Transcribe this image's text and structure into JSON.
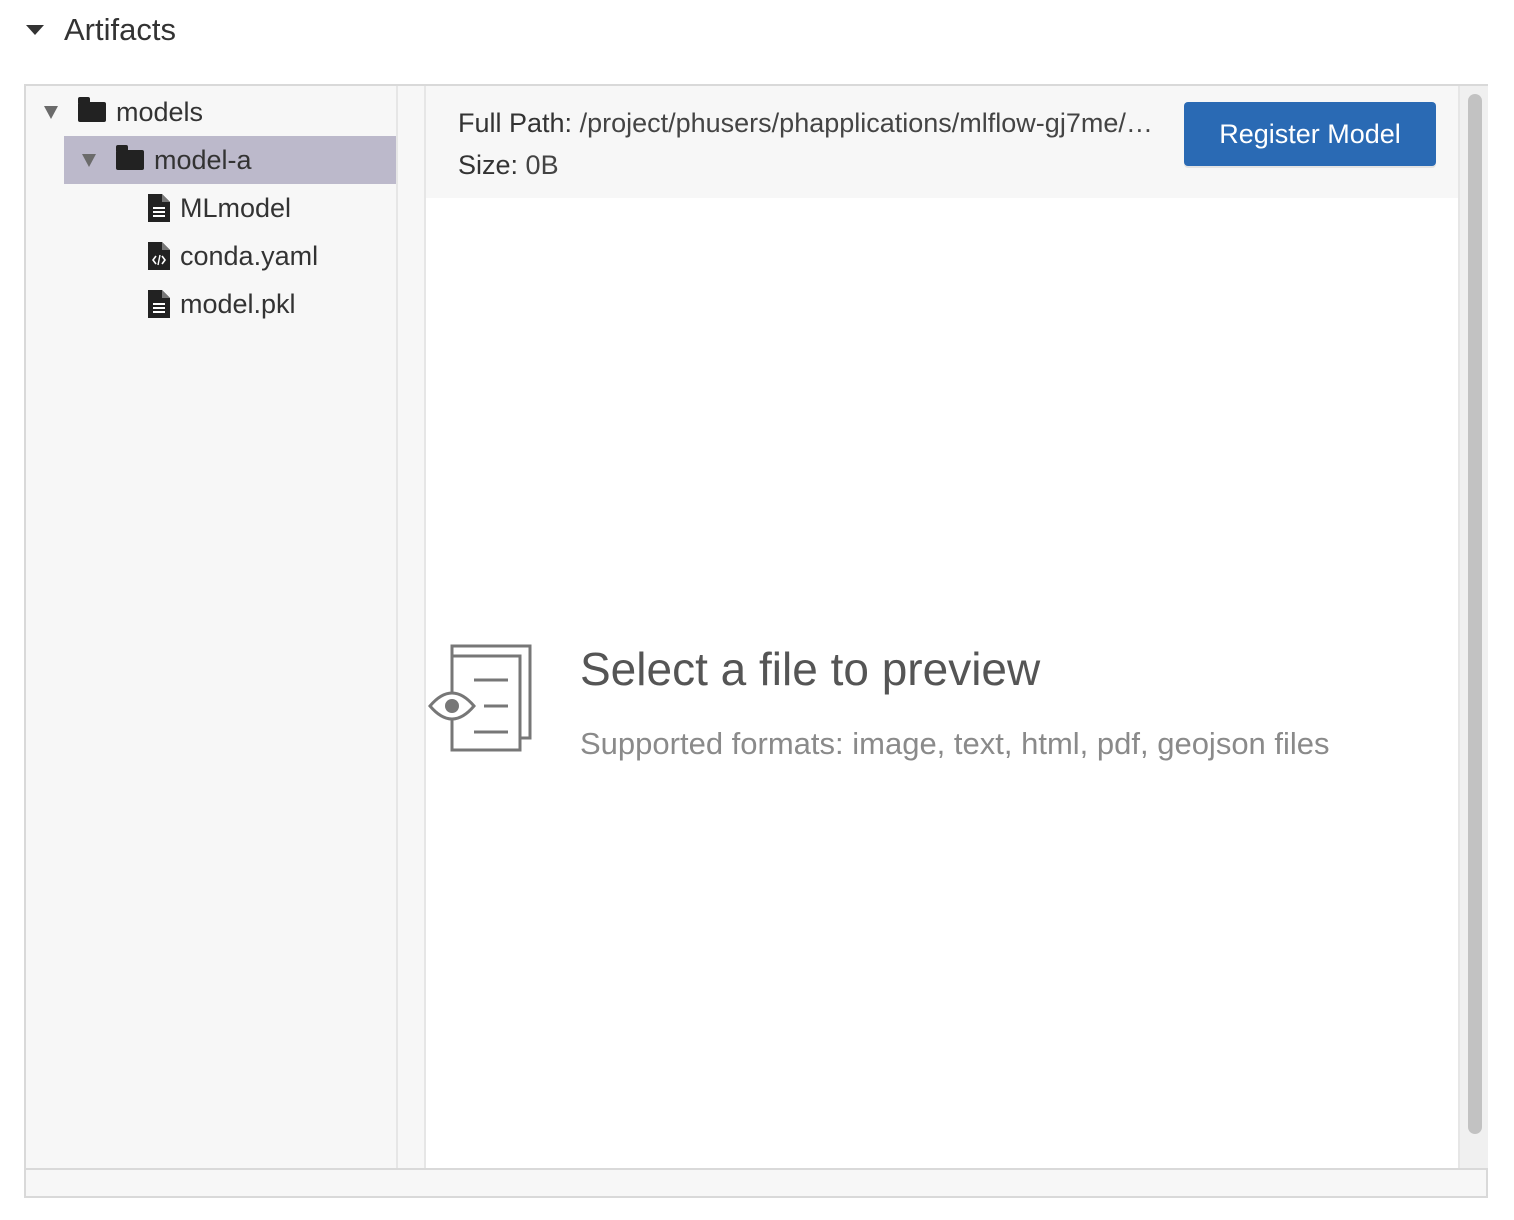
{
  "section": {
    "title": "Artifacts",
    "caret_icon": "caret-down-icon"
  },
  "tree": {
    "root": {
      "label": "models",
      "icon": "folder-icon",
      "expanded": true
    },
    "child": {
      "label": "model-a",
      "icon": "folder-icon",
      "expanded": true,
      "selected": true,
      "selected_color": "#bcb9cb"
    },
    "files": [
      {
        "label": "MLmodel",
        "icon": "file-text-icon"
      },
      {
        "label": "conda.yaml",
        "icon": "file-code-icon"
      },
      {
        "label": "model.pkl",
        "icon": "file-text-icon"
      }
    ]
  },
  "preview": {
    "full_path_label": "Full Path:",
    "full_path_value": "/project/phusers/phapplications/mlflow-gj7me/…",
    "size_label": "Size:",
    "size_value": "0B",
    "register_button": "Register Model",
    "button_color": "#2a6ab4",
    "empty_title": "Select a file to preview",
    "empty_subtitle": "Supported formats: image, text, html, pdf, geojson files",
    "empty_icon": "file-preview-icon"
  }
}
